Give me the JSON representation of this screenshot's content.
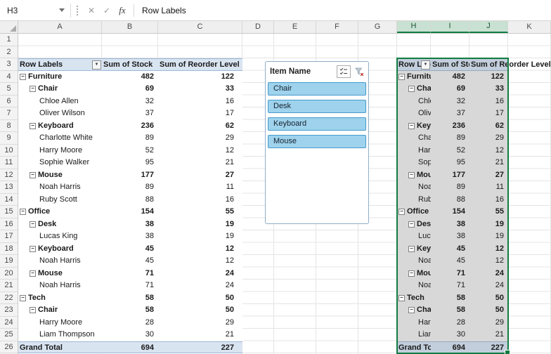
{
  "formula_bar": {
    "name_box": "H3",
    "formula": "Row Labels",
    "cancel_icon": "✕",
    "enter_icon": "✓",
    "fx_icon": "fx"
  },
  "sheet": {
    "columns": [
      {
        "l": "A"
      },
      {
        "l": "B"
      },
      {
        "l": "C"
      },
      {
        "l": "D"
      },
      {
        "l": "E"
      },
      {
        "l": "F"
      },
      {
        "l": "G"
      },
      {
        "l": "H",
        "sel": "sel"
      },
      {
        "l": "I",
        "sel": "sel"
      },
      {
        "l": "J",
        "sel": "sel"
      },
      {
        "l": "K"
      }
    ],
    "row_numbers": [
      {
        "n": 1
      },
      {
        "n": 2
      },
      {
        "n": 3
      },
      {
        "n": 4
      },
      {
        "n": 5
      },
      {
        "n": 6
      },
      {
        "n": 7
      },
      {
        "n": 8
      },
      {
        "n": 9
      },
      {
        "n": 10
      },
      {
        "n": 11
      },
      {
        "n": 12
      },
      {
        "n": 13
      },
      {
        "n": 14
      },
      {
        "n": 15
      },
      {
        "n": 16
      },
      {
        "n": 17
      },
      {
        "n": 18
      },
      {
        "n": 19
      },
      {
        "n": 20
      },
      {
        "n": 21
      },
      {
        "n": 22
      },
      {
        "n": 23
      },
      {
        "n": 24
      },
      {
        "n": 25
      },
      {
        "n": 26
      }
    ]
  },
  "pivot": {
    "headers": [
      "Row Labels",
      "Sum of Stock",
      "Sum of Reorder Level"
    ],
    "rows": [
      {
        "label": "Furniture",
        "stock": 482,
        "reorder": 122,
        "level": "cat"
      },
      {
        "label": "Chair",
        "stock": 69,
        "reorder": 33,
        "level": "sub"
      },
      {
        "label": "Chloe Allen",
        "stock": 32,
        "reorder": 16,
        "level": "leaf"
      },
      {
        "label": "Oliver Wilson",
        "stock": 37,
        "reorder": 17,
        "level": "leaf"
      },
      {
        "label": "Keyboard",
        "stock": 236,
        "reorder": 62,
        "level": "sub"
      },
      {
        "label": "Charlotte White",
        "stock": 89,
        "reorder": 29,
        "level": "leaf"
      },
      {
        "label": "Harry Moore",
        "stock": 52,
        "reorder": 12,
        "level": "leaf"
      },
      {
        "label": "Sophie Walker",
        "stock": 95,
        "reorder": 21,
        "level": "leaf"
      },
      {
        "label": "Mouse",
        "stock": 177,
        "reorder": 27,
        "level": "sub"
      },
      {
        "label": "Noah Harris",
        "stock": 89,
        "reorder": 11,
        "level": "leaf"
      },
      {
        "label": "Ruby Scott",
        "stock": 88,
        "reorder": 16,
        "level": "leaf"
      },
      {
        "label": "Office",
        "stock": 154,
        "reorder": 55,
        "level": "cat"
      },
      {
        "label": "Desk",
        "stock": 38,
        "reorder": 19,
        "level": "sub"
      },
      {
        "label": "Lucas King",
        "stock": 38,
        "reorder": 19,
        "level": "leaf"
      },
      {
        "label": "Keyboard",
        "stock": 45,
        "reorder": 12,
        "level": "sub"
      },
      {
        "label": "Noah Harris",
        "stock": 45,
        "reorder": 12,
        "level": "leaf"
      },
      {
        "label": "Mouse",
        "stock": 71,
        "reorder": 24,
        "level": "sub"
      },
      {
        "label": "Noah Harris",
        "stock": 71,
        "reorder": 24,
        "level": "leaf"
      },
      {
        "label": "Tech",
        "stock": 58,
        "reorder": 50,
        "level": "cat"
      },
      {
        "label": "Chair",
        "stock": 58,
        "reorder": 50,
        "level": "sub"
      },
      {
        "label": "Harry Moore",
        "stock": 28,
        "reorder": 29,
        "level": "leaf"
      },
      {
        "label": "Liam Thompson",
        "stock": 30,
        "reorder": 21,
        "level": "leaf"
      }
    ],
    "grand_total": {
      "label": "Grand Total",
      "stock": 694,
      "reorder": 227
    }
  },
  "slicer": {
    "title": "Item Name",
    "items": [
      {
        "label": "Chair"
      },
      {
        "label": "Desk"
      },
      {
        "label": "Keyboard"
      },
      {
        "label": "Mouse"
      }
    ]
  }
}
